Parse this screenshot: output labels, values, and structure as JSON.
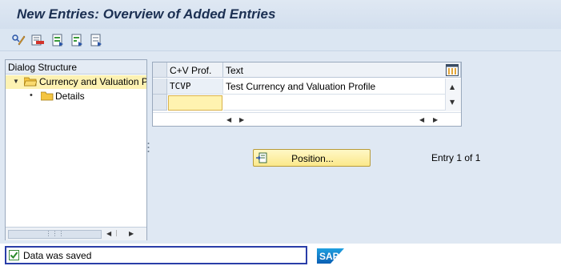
{
  "window": {
    "title": "New Entries: Overview of Added Entries"
  },
  "toolbar": {
    "icons": [
      "display-change-icon",
      "delete-row-icon",
      "select-all-icon",
      "select-block-icon",
      "deselect-all-icon"
    ]
  },
  "dialog_structure": {
    "header": "Dialog Structure",
    "items": [
      {
        "label": "Currency and Valuation Profile",
        "selected": true,
        "expanded": true
      },
      {
        "label": "Details",
        "selected": false
      }
    ]
  },
  "table": {
    "columns": [
      "C+V Prof.",
      "Text"
    ],
    "rows": [
      {
        "prof": "TCVP",
        "text": "Test Currency and Valuation Profile"
      },
      {
        "prof": "",
        "text": ""
      }
    ]
  },
  "position_button": {
    "label": "Position..."
  },
  "entry_info": "Entry 1 of 1",
  "status_bar": {
    "message": "Data was saved"
  },
  "brand": {
    "logo_text": "SAP",
    "accent": "#2a3ea8"
  }
}
